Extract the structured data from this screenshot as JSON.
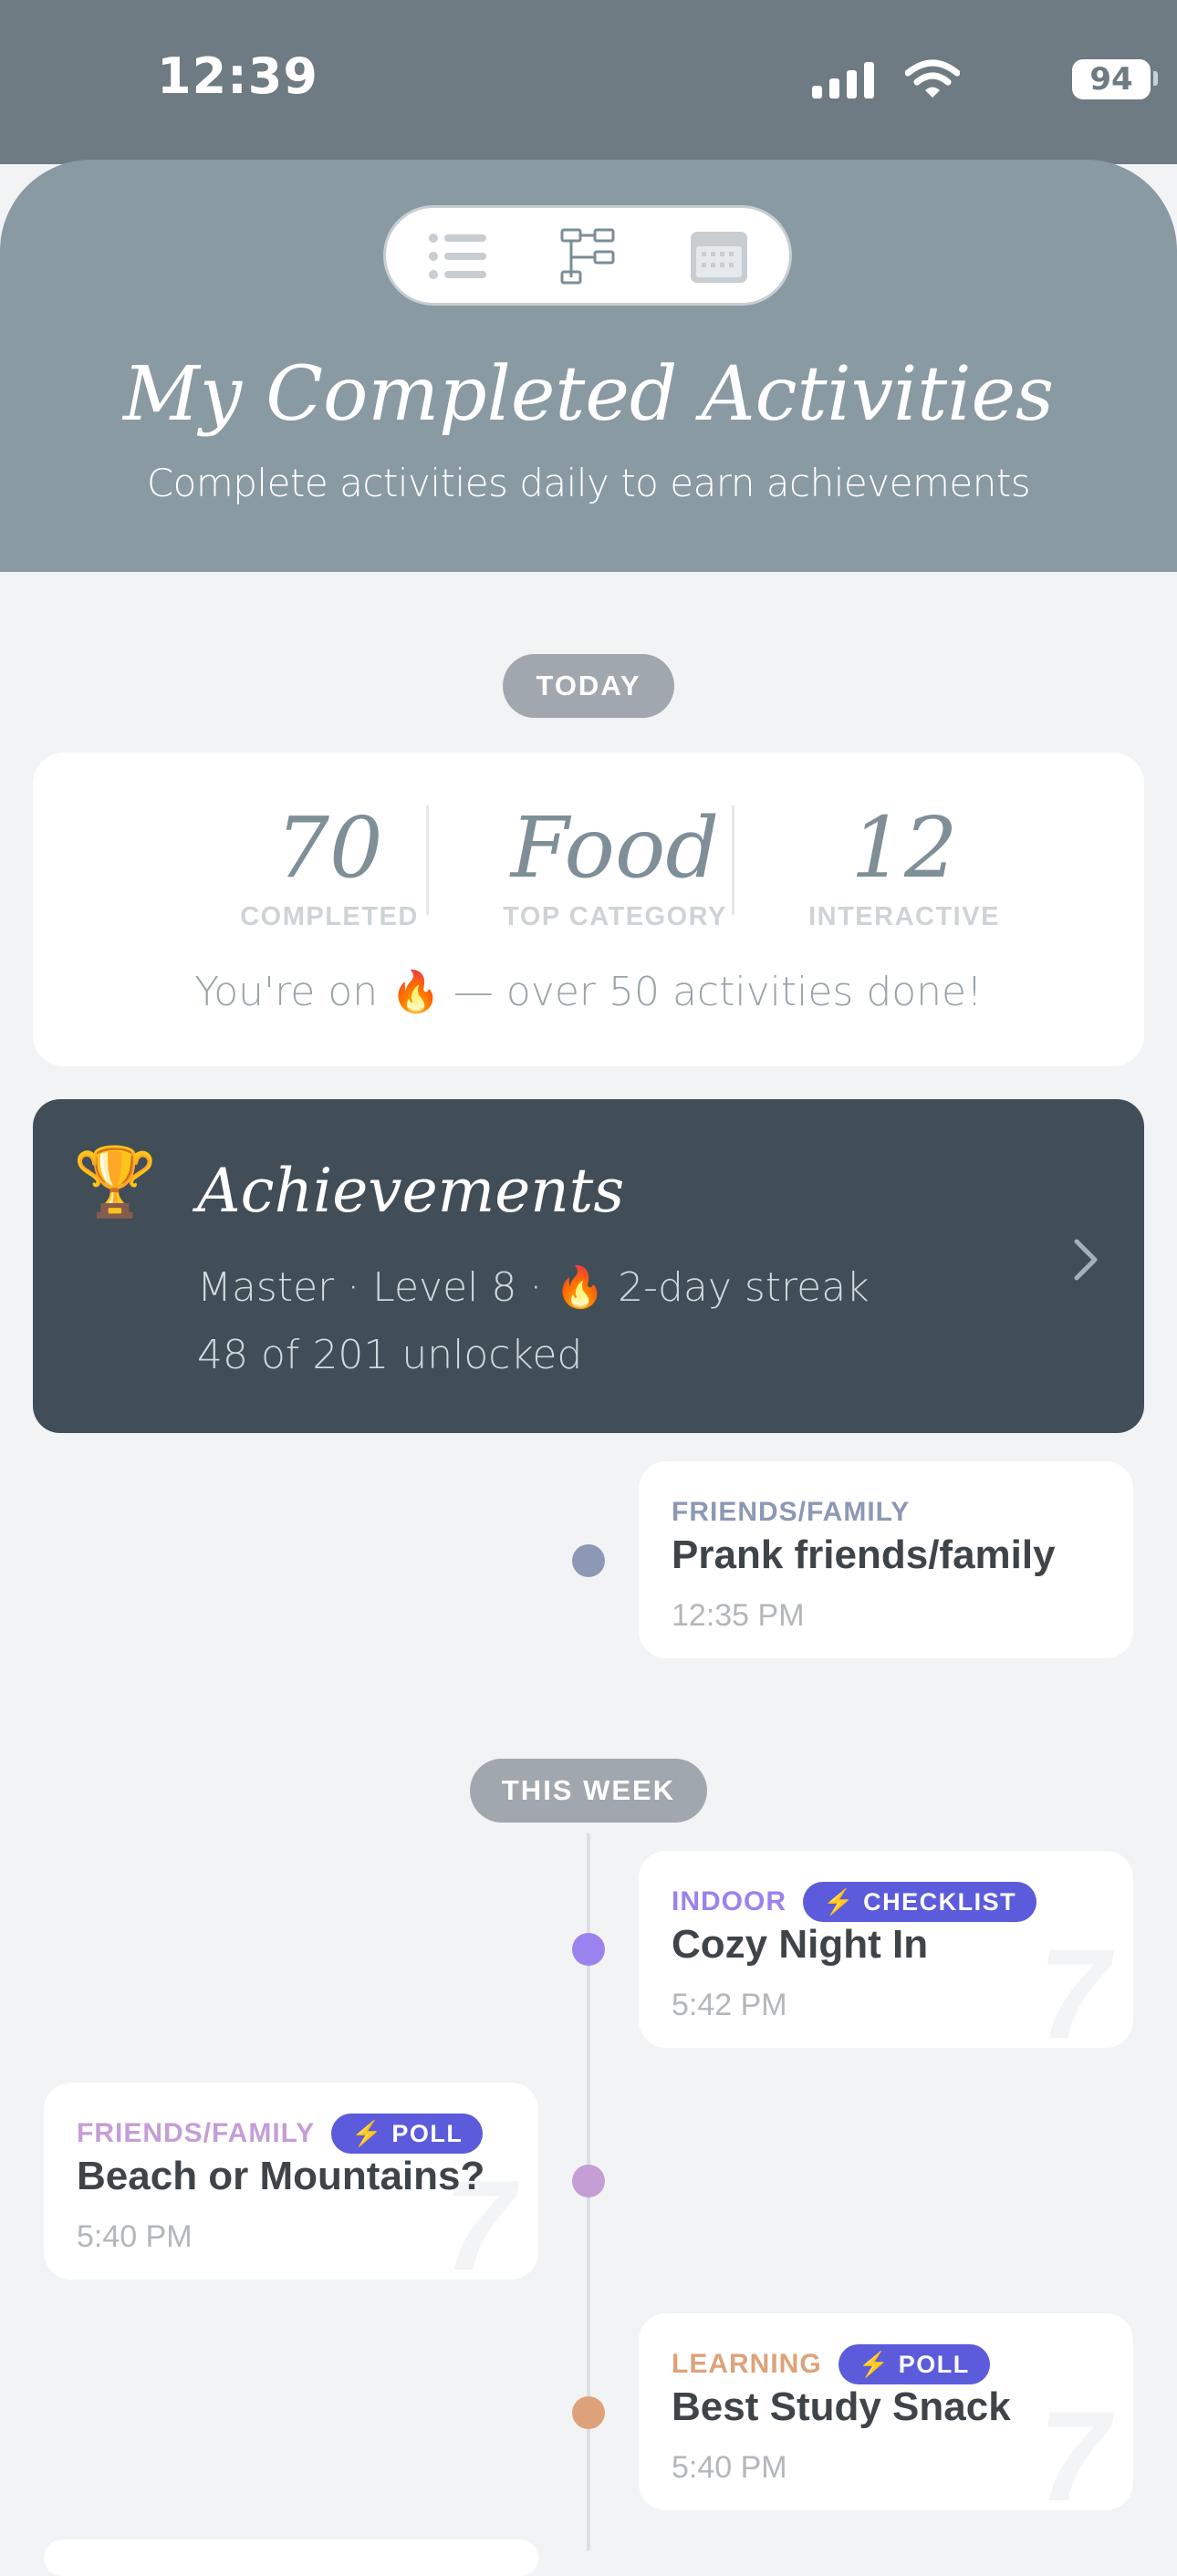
{
  "status_bar": {
    "time": "12:39",
    "battery": "94"
  },
  "header": {
    "title": "My Completed Activities",
    "subtitle": "Complete activities daily to earn achievements",
    "view_switcher": [
      "list-view-icon",
      "tree-view-icon",
      "calendar-view-icon"
    ]
  },
  "sections": {
    "today": "TODAY",
    "this_week": "THIS WEEK"
  },
  "stats": {
    "completed_value": "70",
    "completed_label": "COMPLETED",
    "category_value": "Food",
    "category_label": "TOP CATEGORY",
    "interactive_value": "12",
    "interactive_label": "INTERACTIVE",
    "note": "You're on 🔥 — over 50 activities done!"
  },
  "achievements": {
    "icon": "🏆",
    "title": "Achievements",
    "subtitle": "Master · Level 8 · 🔥 2-day streak",
    "unlocked": "48 of 201 unlocked"
  },
  "activities": [
    {
      "category": "FRIENDS/FAMILY",
      "title": "Prank friends/family",
      "time": "12:35 PM",
      "color": "#8c98b4"
    },
    {
      "category": "INDOOR",
      "badge": "⚡ CHECKLIST",
      "title": "Cozy Night In",
      "time": "5:42 PM",
      "color": "#9b82ee",
      "watermark": "7"
    },
    {
      "category": "FRIENDS/FAMILY",
      "badge": "⚡ POLL",
      "title": "Beach or Mountains?",
      "time": "5:40 PM",
      "color": "#c59ed5",
      "watermark": "7"
    },
    {
      "category": "LEARNING",
      "badge": "⚡ POLL",
      "title": "Best Study Snack",
      "time": "5:40 PM",
      "color": "#dea27a",
      "watermark": "7"
    }
  ],
  "colors": {
    "header": "#8a9aa2",
    "status_bar": "#6e7b83",
    "achievements_bg": "#414e57",
    "badge": "#5b5bdb"
  }
}
